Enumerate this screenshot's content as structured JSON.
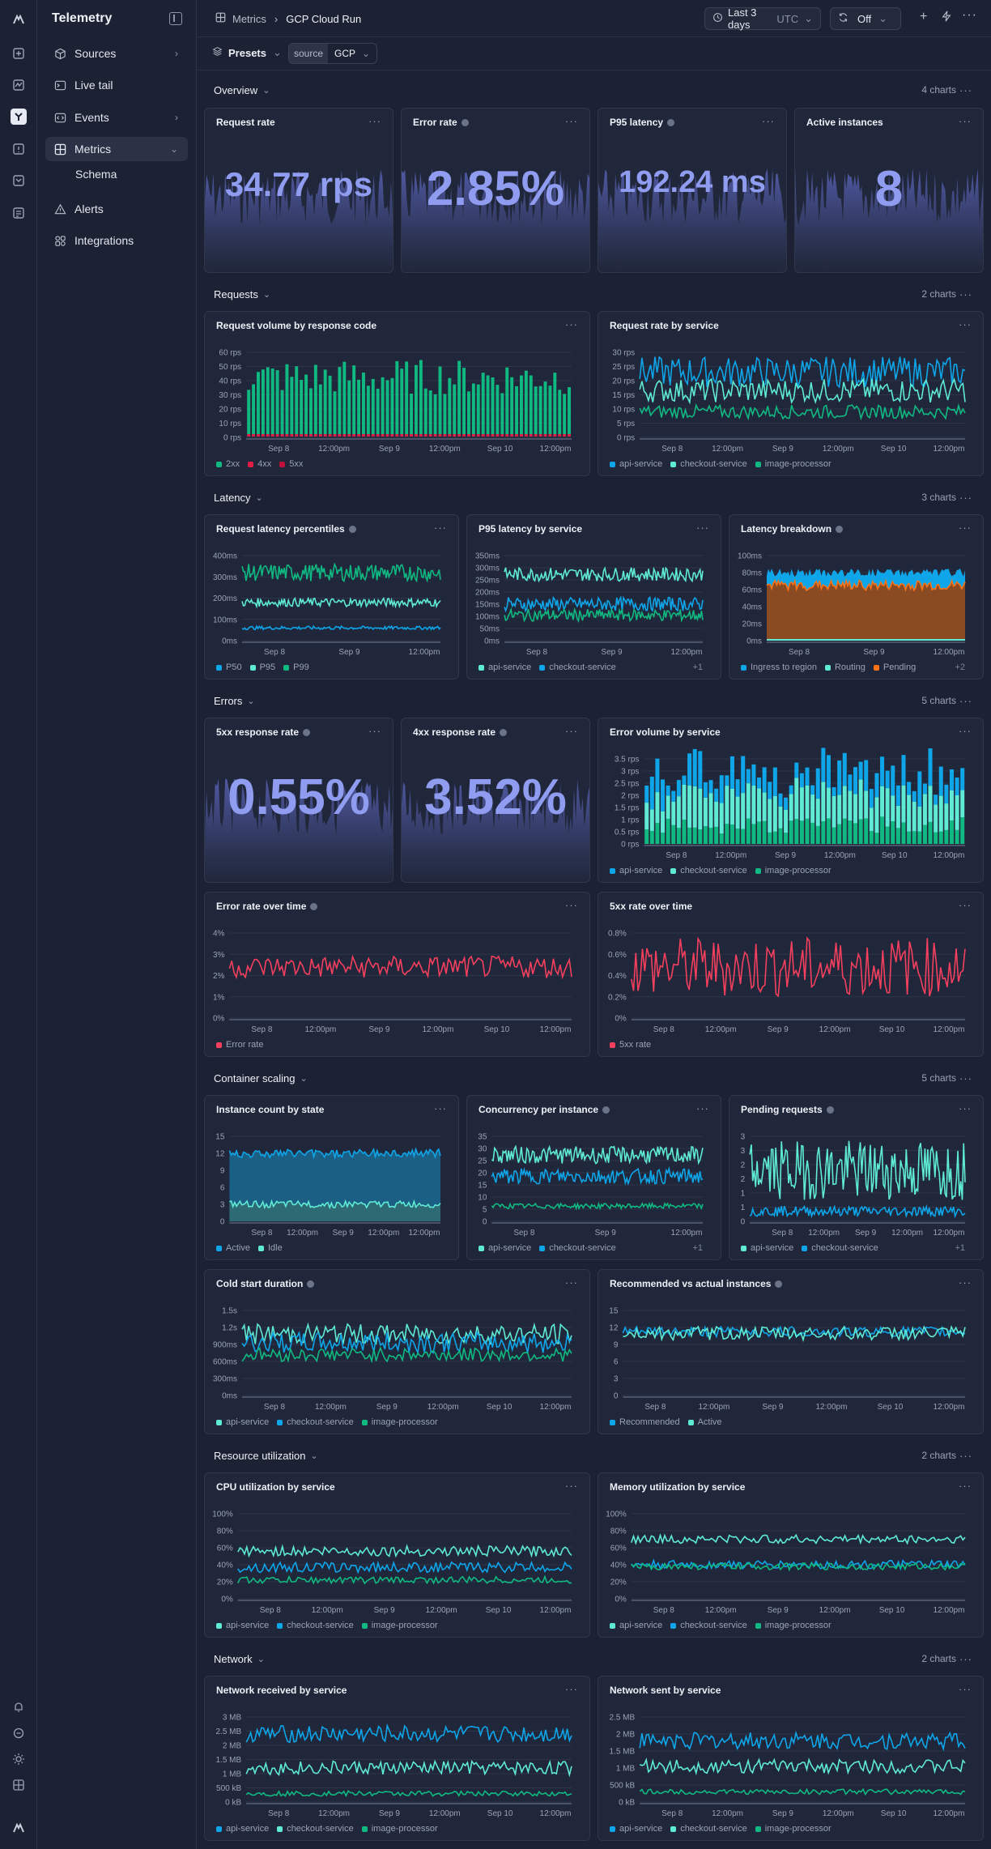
{
  "app": {
    "name": "Telemetry"
  },
  "sidebar": {
    "items": [
      {
        "label": "Sources",
        "icon": "cube-icon",
        "has_chevron": true
      },
      {
        "label": "Live tail",
        "icon": "terminal-icon",
        "has_chevron": false
      },
      {
        "label": "Events",
        "icon": "code-icon",
        "has_chevron": true
      },
      {
        "label": "Metrics",
        "icon": "grid-icon",
        "has_chevron": true,
        "selected": true
      },
      {
        "label": "Alerts",
        "icon": "alert-icon",
        "has_chevron": false
      },
      {
        "label": "Integrations",
        "icon": "integrations-icon",
        "has_chevron": false
      }
    ],
    "sub": {
      "label": "Schema"
    }
  },
  "breadcrumb": {
    "root": "Metrics",
    "current": "GCP Cloud Run"
  },
  "topbar": {
    "range": "Last 3 days",
    "tz": "UTC",
    "refresh": "Off"
  },
  "filters": {
    "presets": "Presets",
    "source_key": "source",
    "source_value": "GCP"
  },
  "colors": {
    "accent": "#8f9cf0",
    "green": "#10b981",
    "red": "#e11d48",
    "blue": "#0ea5e9",
    "teal": "#5eead4",
    "orange": "#f97316",
    "crimson": "#f43f5e"
  },
  "sections": [
    {
      "title": "Overview",
      "count": "4 charts"
    },
    {
      "title": "Requests",
      "count": "2 charts"
    },
    {
      "title": "Latency",
      "count": "3 charts"
    },
    {
      "title": "Errors",
      "count": "5 charts"
    },
    {
      "title": "Container scaling",
      "count": "5 charts"
    },
    {
      "title": "Resource utilization",
      "count": "2 charts"
    },
    {
      "title": "Network",
      "count": "2 charts"
    }
  ],
  "stats": [
    {
      "title": "Request rate",
      "value": "34.77 rps",
      "info": false
    },
    {
      "title": "Error rate",
      "value": "2.85%",
      "info": true
    },
    {
      "title": "P95 latency",
      "value": "192.24 ms",
      "info": true
    },
    {
      "title": "Active instances",
      "value": "8",
      "info": false
    },
    {
      "title": "5xx response rate",
      "value": "0.55%",
      "info": true
    },
    {
      "title": "4xx response rate",
      "value": "3.52%",
      "info": true
    }
  ],
  "chart_data": [
    {
      "title": "Request volume by response code",
      "type": "bar",
      "y_ticks": [
        "60 rps",
        "50 rps",
        "40 rps",
        "30 rps",
        "20 rps",
        "10 rps",
        "0 rps"
      ],
      "x_ticks": [
        "Sep 8",
        "12:00pm",
        "Sep 9",
        "12:00pm",
        "Sep 10",
        "12:00pm"
      ],
      "series": [
        {
          "name": "2xx"
        },
        {
          "name": "4xx"
        },
        {
          "name": "5xx"
        }
      ],
      "ylim": [
        0,
        60
      ]
    },
    {
      "title": "Request rate by service",
      "type": "line",
      "y_ticks": [
        "30 rps",
        "25 rps",
        "20 rps",
        "15 rps",
        "10 rps",
        "5 rps",
        "0 rps"
      ],
      "x_ticks": [
        "Sep 8",
        "12:00pm",
        "Sep 9",
        "12:00pm",
        "Sep 10",
        "12:00pm"
      ],
      "series": [
        {
          "name": "api-service"
        },
        {
          "name": "checkout-service"
        },
        {
          "name": "image-processor"
        }
      ],
      "ylim": [
        0,
        30
      ]
    },
    {
      "title": "Request latency percentiles",
      "type": "line",
      "info": true,
      "y_ticks": [
        "400ms",
        "300ms",
        "200ms",
        "100ms",
        "0ms"
      ],
      "x_ticks": [
        "Sep 8",
        "Sep 9",
        "12:00pm"
      ],
      "series": [
        {
          "name": "P50"
        },
        {
          "name": "P95"
        },
        {
          "name": "P99"
        }
      ],
      "ylim": [
        0,
        400
      ]
    },
    {
      "title": "P95 latency by service",
      "type": "line",
      "y_ticks": [
        "350ms",
        "300ms",
        "250ms",
        "200ms",
        "150ms",
        "100ms",
        "50ms",
        "0ms"
      ],
      "x_ticks": [
        "Sep 8",
        "Sep 9",
        "12:00pm"
      ],
      "series": [
        {
          "name": "api-service"
        },
        {
          "name": "checkout-service"
        }
      ],
      "more": "+1",
      "ylim": [
        0,
        350
      ]
    },
    {
      "title": "Latency breakdown",
      "type": "area",
      "info": true,
      "y_ticks": [
        "100ms",
        "80ms",
        "60ms",
        "40ms",
        "20ms",
        "0ms"
      ],
      "x_ticks": [
        "Sep 8",
        "Sep 9",
        "12:00pm"
      ],
      "series": [
        {
          "name": "Ingress to region"
        },
        {
          "name": "Routing"
        },
        {
          "name": "Pending"
        }
      ],
      "more": "+2",
      "ylim": [
        0,
        100
      ]
    },
    {
      "title": "Error volume by service",
      "type": "bar",
      "y_ticks": [
        "3.5 rps",
        "3 rps",
        "2.5 rps",
        "2 rps",
        "1.5 rps",
        "1 rps",
        "0.5 rps",
        "0 rps"
      ],
      "x_ticks": [
        "Sep 8",
        "12:00pm",
        "Sep 9",
        "12:00pm",
        "Sep 10",
        "12:00pm"
      ],
      "series": [
        {
          "name": "api-service"
        },
        {
          "name": "checkout-service"
        },
        {
          "name": "image-processor"
        }
      ],
      "ylim": [
        0,
        3.5
      ]
    },
    {
      "title": "Error rate over time",
      "type": "line",
      "info": true,
      "y_ticks": [
        "4%",
        "3%",
        "2%",
        "1%",
        "0%"
      ],
      "x_ticks": [
        "Sep 8",
        "12:00pm",
        "Sep 9",
        "12:00pm",
        "Sep 10",
        "12:00pm"
      ],
      "series": [
        {
          "name": "Error rate"
        }
      ],
      "ylim": [
        0,
        4
      ]
    },
    {
      "title": "5xx rate over time",
      "type": "line",
      "y_ticks": [
        "0.8%",
        "0.6%",
        "0.4%",
        "0.2%",
        "0%"
      ],
      "x_ticks": [
        "Sep 8",
        "12:00pm",
        "Sep 9",
        "12:00pm",
        "Sep 10",
        "12:00pm"
      ],
      "series": [
        {
          "name": "5xx rate"
        }
      ],
      "ylim": [
        0,
        0.8
      ]
    },
    {
      "title": "Instance count by state",
      "type": "area",
      "y_ticks": [
        "15",
        "12",
        "9",
        "6",
        "3",
        "0"
      ],
      "x_ticks": [
        "Sep 8",
        "12:00pm",
        "Sep 9",
        "12:00pm",
        "12:00pm"
      ],
      "series": [
        {
          "name": "Active"
        },
        {
          "name": "Idle"
        }
      ],
      "ylim": [
        0,
        15
      ]
    },
    {
      "title": "Concurrency per instance",
      "type": "line",
      "info": true,
      "y_ticks": [
        "35",
        "30",
        "25",
        "20",
        "15",
        "10",
        "5",
        "0"
      ],
      "x_ticks": [
        "Sep 8",
        "Sep 9",
        "12:00pm"
      ],
      "series": [
        {
          "name": "api-service"
        },
        {
          "name": "checkout-service"
        }
      ],
      "more": "+1",
      "ylim": [
        0,
        35
      ]
    },
    {
      "title": "Pending requests",
      "type": "line",
      "info": true,
      "y_ticks": [
        "3",
        "3",
        "2",
        "2",
        "1",
        "1",
        "0"
      ],
      "x_ticks": [
        "Sep 8",
        "12:00pm",
        "Sep 9",
        "12:00pm",
        "12:00pm"
      ],
      "series": [
        {
          "name": "api-service"
        },
        {
          "name": "checkout-service"
        }
      ],
      "more": "+1",
      "ylim": [
        0,
        3
      ]
    },
    {
      "title": "Cold start duration",
      "type": "line",
      "info": true,
      "y_ticks": [
        "1.5s",
        "1.2s",
        "900ms",
        "600ms",
        "300ms",
        "0ms"
      ],
      "x_ticks": [
        "Sep 8",
        "12:00pm",
        "Sep 9",
        "12:00pm",
        "Sep 10",
        "12:00pm"
      ],
      "series": [
        {
          "name": "api-service"
        },
        {
          "name": "checkout-service"
        },
        {
          "name": "image-processor"
        }
      ],
      "ylim": [
        0,
        1.5
      ]
    },
    {
      "title": "Recommended vs actual instances",
      "type": "line",
      "info": true,
      "y_ticks": [
        "15",
        "12",
        "9",
        "6",
        "3",
        "0"
      ],
      "x_ticks": [
        "Sep 8",
        "12:00pm",
        "Sep 9",
        "12:00pm",
        "Sep 10",
        "12:00pm"
      ],
      "series": [
        {
          "name": "Recommended"
        },
        {
          "name": "Active"
        }
      ],
      "ylim": [
        0,
        15
      ]
    },
    {
      "title": "CPU utilization by service",
      "type": "line",
      "y_ticks": [
        "100%",
        "80%",
        "60%",
        "40%",
        "20%",
        "0%"
      ],
      "x_ticks": [
        "Sep 8",
        "12:00pm",
        "Sep 9",
        "12:00pm",
        "Sep 10",
        "12:00pm"
      ],
      "series": [
        {
          "name": "api-service"
        },
        {
          "name": "checkout-service"
        },
        {
          "name": "image-processor"
        }
      ],
      "ylim": [
        0,
        100
      ]
    },
    {
      "title": "Memory utilization by service",
      "type": "line",
      "y_ticks": [
        "100%",
        "80%",
        "60%",
        "40%",
        "20%",
        "0%"
      ],
      "x_ticks": [
        "Sep 8",
        "12:00pm",
        "Sep 9",
        "12:00pm",
        "Sep 10",
        "12:00pm"
      ],
      "series": [
        {
          "name": "api-service"
        },
        {
          "name": "checkout-service"
        },
        {
          "name": "image-processor"
        }
      ],
      "ylim": [
        0,
        100
      ]
    },
    {
      "title": "Network received by service",
      "type": "line",
      "y_ticks": [
        "3 MB",
        "2.5 MB",
        "2 MB",
        "1.5 MB",
        "1 MB",
        "500 kB",
        "0 kB"
      ],
      "x_ticks": [
        "Sep 8",
        "12:00pm",
        "Sep 9",
        "12:00pm",
        "Sep 10",
        "12:00pm"
      ],
      "series": [
        {
          "name": "api-service"
        },
        {
          "name": "checkout-service"
        },
        {
          "name": "image-processor"
        }
      ],
      "ylim": [
        0,
        3
      ]
    },
    {
      "title": "Network sent by service",
      "type": "line",
      "y_ticks": [
        "2.5 MB",
        "2 MB",
        "1.5 MB",
        "1 MB",
        "500 kB",
        "0 kB"
      ],
      "x_ticks": [
        "Sep 8",
        "12:00pm",
        "Sep 9",
        "12:00pm",
        "Sep 10",
        "12:00pm"
      ],
      "series": [
        {
          "name": "api-service"
        },
        {
          "name": "checkout-service"
        },
        {
          "name": "image-processor"
        }
      ],
      "ylim": [
        0,
        2.5
      ]
    }
  ]
}
